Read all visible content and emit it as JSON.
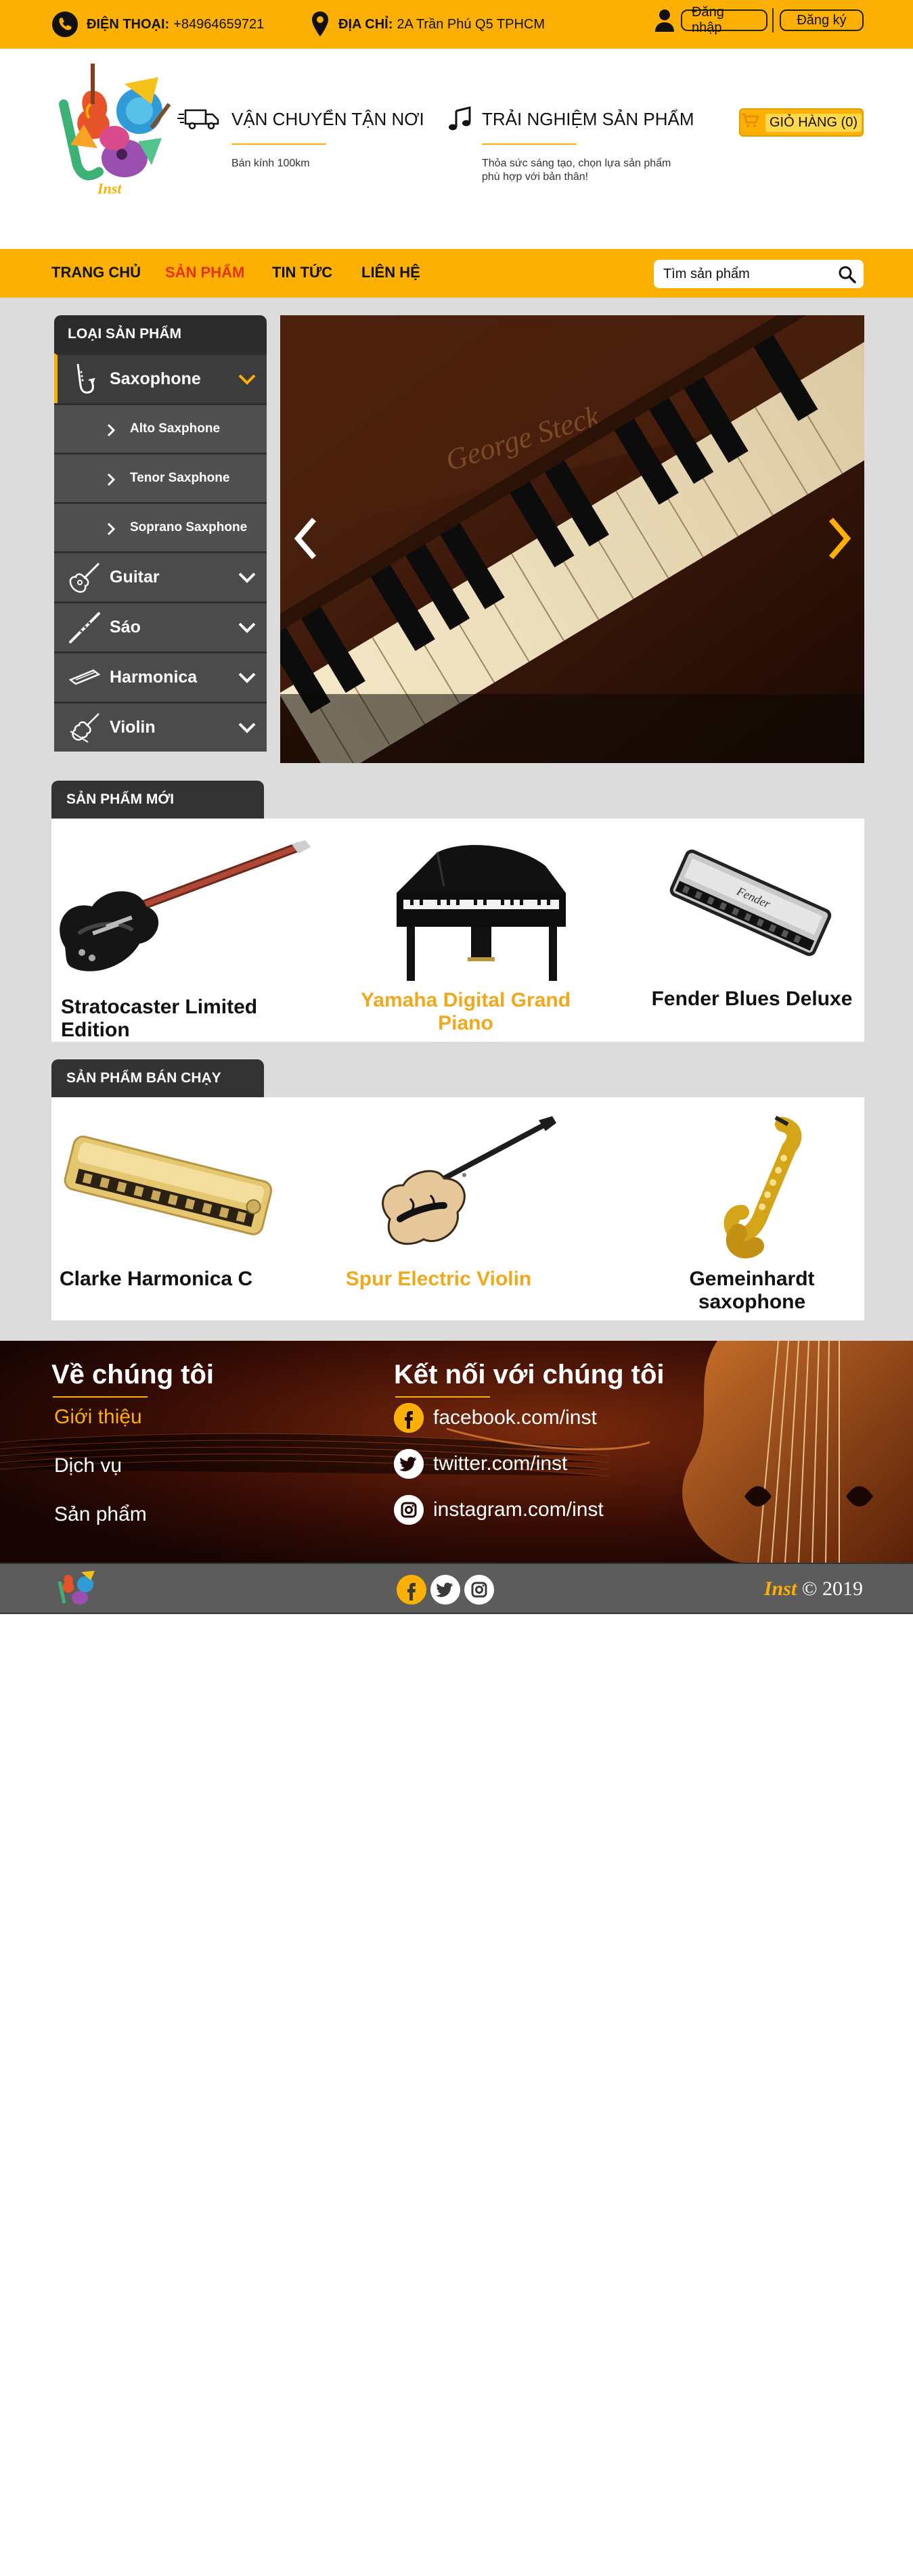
{
  "topbar": {
    "phone_label": "ĐIỆN THOẠI:",
    "phone_value": "+84964659721",
    "address_label": "ĐỊA CHỈ:",
    "address_value": "2A Trần Phú Q5 TPHCM",
    "login_label": "Đăng nhập",
    "register_label": "Đăng ký"
  },
  "header": {
    "logo_text": "Inst",
    "features": [
      {
        "title": "VẬN CHUYỂN TẬN NƠI",
        "desc": "Bán kính 100km",
        "icon": "truck-icon"
      },
      {
        "title": "TRẢI NGHIỆM SẢN PHẨM",
        "desc": "Thỏa sức sáng tạo, chọn lựa sản phẩm phù hợp với bản thân!",
        "icon": "music-note-icon"
      }
    ],
    "cart_label": "GIỎ HÀNG (0)"
  },
  "nav": {
    "items": [
      "TRANG CHỦ",
      "SẢN PHẨM",
      "TIN TỨC",
      "LIÊN HỆ"
    ],
    "active_index": 1,
    "search_placeholder": "Tìm sản phẩm"
  },
  "sidebar": {
    "title": "LOẠI SẢN PHẨM",
    "categories": [
      {
        "label": "Saxophone",
        "icon": "saxophone-icon",
        "expanded": true,
        "children": [
          "Alto Saxphone",
          "Tenor Saxphone",
          "Soprano Saxphone"
        ]
      },
      {
        "label": "Guitar",
        "icon": "guitar-icon"
      },
      {
        "label": "Sáo",
        "icon": "flute-icon"
      },
      {
        "label": "Harmonica",
        "icon": "harmonica-icon"
      },
      {
        "label": "Violin",
        "icon": "violin-icon"
      }
    ]
  },
  "new_products": {
    "title": "SẢN PHẨM MỚI",
    "items": [
      {
        "name": "Stratocaster Limited Edition",
        "highlight": false
      },
      {
        "name": "Yamaha Digital Grand Piano",
        "highlight": true
      },
      {
        "name": "Fender Blues Deluxe",
        "highlight": false
      }
    ]
  },
  "best_sellers": {
    "title": "SẢN PHẨM BÁN CHẠY",
    "items": [
      {
        "name": "Clarke Harmonica C",
        "highlight": false
      },
      {
        "name": "Spur Electric Violin",
        "highlight": true
      },
      {
        "name": "Gemeinhardt saxophone",
        "highlight": false
      }
    ]
  },
  "footer": {
    "about_title": "Về chúng tôi",
    "about_links": [
      "Giới thiệu",
      "Dịch vụ",
      "Sản phẩm"
    ],
    "connect_title": "Kết nối với chúng tôi",
    "socials": [
      "facebook.com/inst",
      "twitter.com/inst",
      "instagram.com/inst"
    ],
    "copyright_brand": "Inst",
    "copyright_text": "© 2019"
  },
  "colors": {
    "accent": "#fbb003",
    "active_nav": "#e53411",
    "highlight_name": "#f1a81c",
    "dark_panel": "#4b4b4b"
  }
}
